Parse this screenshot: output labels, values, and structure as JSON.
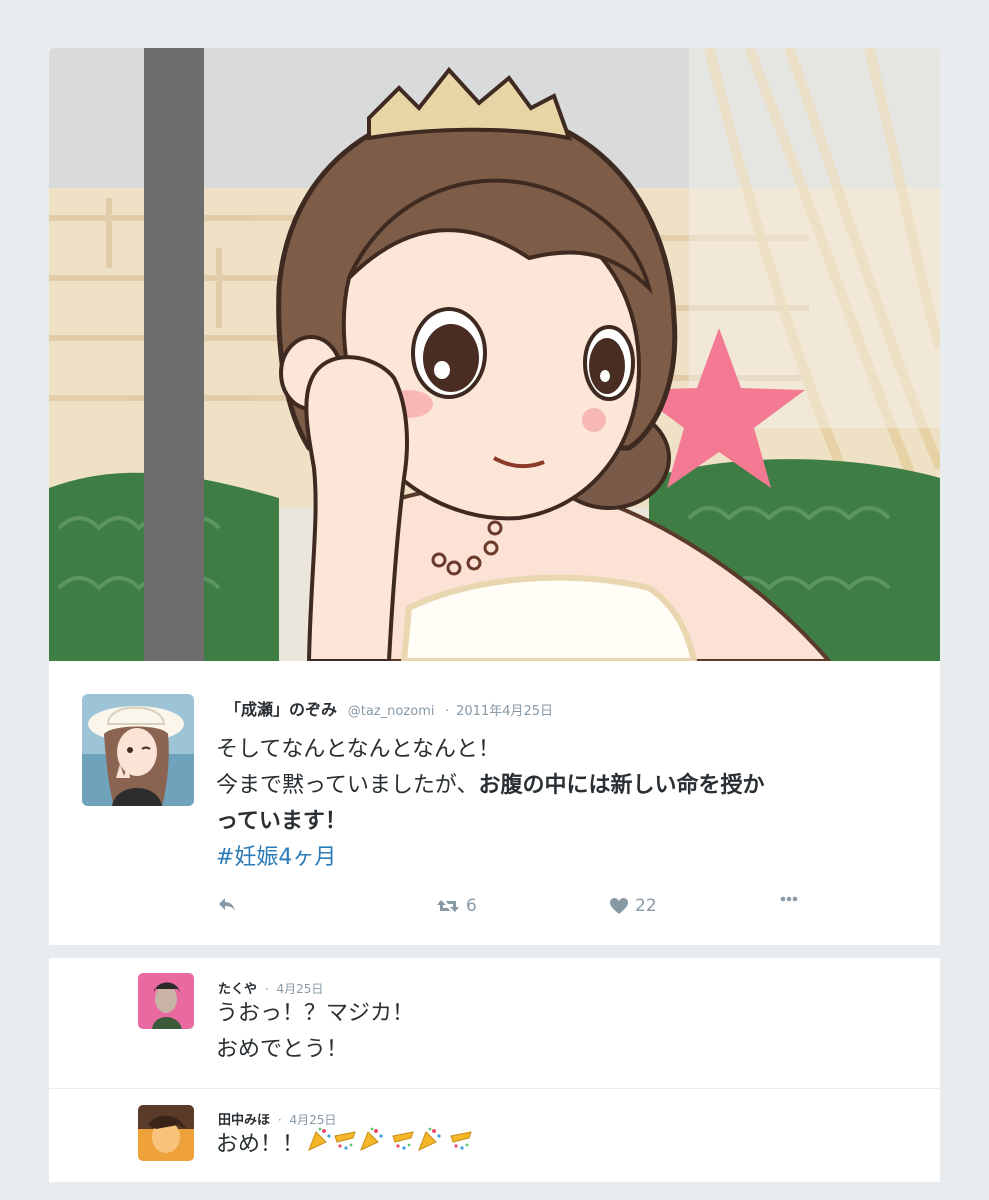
{
  "tweet": {
    "name": "「成瀬」のぞみ",
    "handle": "@taz_nozomi",
    "date": "2011年4月25日",
    "line1": "そしてなんとなんとなんと！",
    "line2_plain": "今まで黙っていましたが、",
    "line2_bold": "お腹の中には新しい命を授か",
    "line3_bold": "っています！",
    "hashtag": "#妊娠4ヶ月",
    "retweet_count": "6",
    "like_count": "22"
  },
  "replies": [
    {
      "name": "たくや",
      "date": "4月25日",
      "line1": "うおっ！？マジカ！",
      "line2": "おめでとう！"
    },
    {
      "name": "田中みほ",
      "date": "4月25日",
      "text": "おめ！！"
    }
  ],
  "icons": {
    "reply": "reply-icon",
    "retweet": "retweet-icon",
    "like": "heart-icon",
    "more": "more-icon",
    "party": "party-popper-icon"
  },
  "colors": {
    "name_text": "#292f33",
    "meta_text": "#8899a6",
    "hashtag": "#2b7bb9",
    "star": "#f47a93",
    "background": "#e9ecef"
  }
}
